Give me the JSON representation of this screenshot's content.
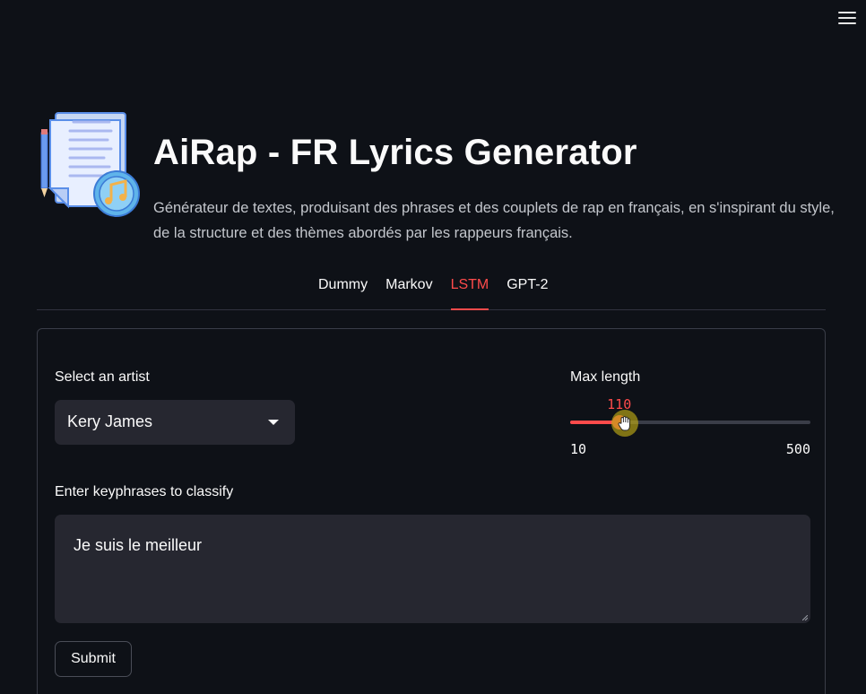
{
  "header": {
    "title": "AiRap - FR Lyrics Generator",
    "subtitle": "Générateur de textes, produisant des phrases et des couplets de rap en français, en s'inspirant du style, de la structure et des thèmes abordés par les rappeurs français.",
    "logo_icon": "lyrics-document-music-note-icon"
  },
  "menu": {
    "icon": "hamburger-menu-icon"
  },
  "tabs": [
    {
      "label": "Dummy",
      "active": false
    },
    {
      "label": "Markov",
      "active": false
    },
    {
      "label": "LSTM",
      "active": true
    },
    {
      "label": "GPT-2",
      "active": false
    }
  ],
  "form": {
    "artist_label": "Select an artist",
    "artist_value": "Kery James",
    "max_length": {
      "label": "Max length",
      "value": "110",
      "min": "10",
      "max": "500",
      "value_num": 110,
      "min_num": 10,
      "max_num": 500
    },
    "keyphrases_label": "Enter keyphrases to classify",
    "keyphrases_value": "Je suis le meilleur",
    "submit_label": "Submit"
  },
  "colors": {
    "accent": "#ff4b4b",
    "background": "#0e1117",
    "input_bg": "#262730"
  }
}
